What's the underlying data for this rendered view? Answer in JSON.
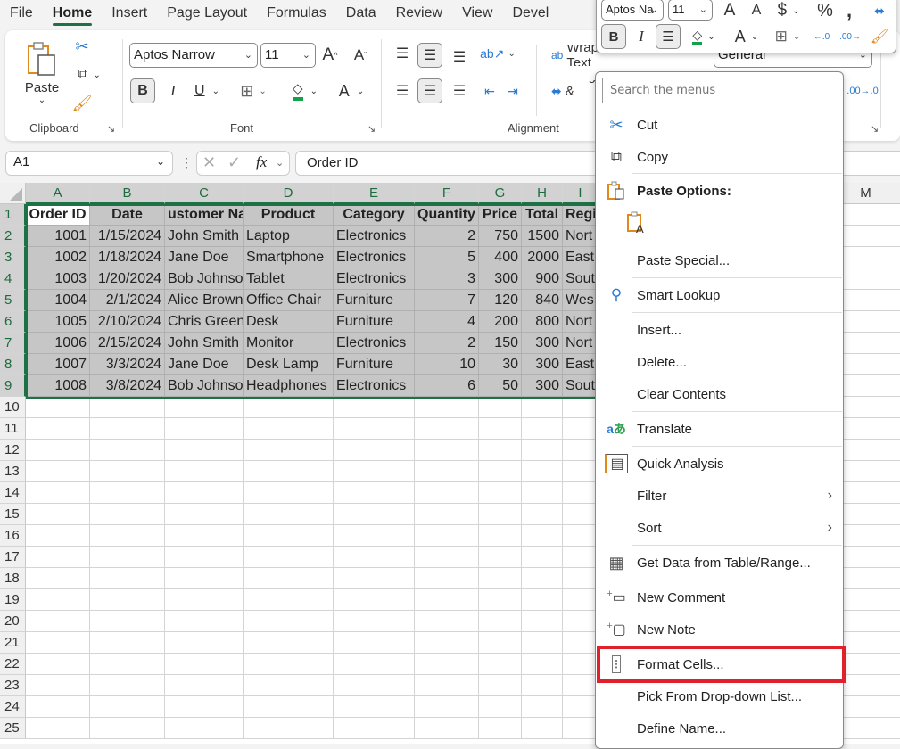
{
  "tabs": [
    "File",
    "Home",
    "Insert",
    "Page Layout",
    "Formulas",
    "Data",
    "Review",
    "View",
    "Devel"
  ],
  "active_tab": "Home",
  "ribbon": {
    "clipboard": {
      "label": "Clipboard",
      "paste": "Paste"
    },
    "font": {
      "label": "Font",
      "name": "Aptos Narrow",
      "size": "11",
      "bold": "B",
      "italic": "I",
      "underline": "U",
      "font_color": "A"
    },
    "alignment": {
      "label": "Alignment",
      "wrap_text": "Wrap Text",
      "merge": "Merge & Center"
    },
    "number": {
      "format": "General"
    }
  },
  "mini_toolbar": {
    "font": "Aptos Na",
    "size": "11",
    "bold": "B",
    "italic": "I",
    "font_color": "A"
  },
  "formula_bar": {
    "name_box": "A1",
    "fx": "fx",
    "value": "Order ID"
  },
  "columns": [
    "A",
    "B",
    "C",
    "D",
    "E",
    "F",
    "G",
    "H",
    "I",
    "M"
  ],
  "rows": [
    "1",
    "2",
    "3",
    "4",
    "5",
    "6",
    "7",
    "8",
    "9",
    "10",
    "11",
    "12",
    "13",
    "14",
    "15",
    "16",
    "17",
    "18",
    "19",
    "20",
    "21",
    "22",
    "23",
    "24",
    "25"
  ],
  "table": {
    "headers": [
      "Order ID",
      "Date",
      "ustomer Nan",
      "Product",
      "Category",
      "Quantity",
      "Price",
      "Total",
      "Regi"
    ],
    "data": [
      [
        "1001",
        "1/15/2024",
        "John Smith",
        "Laptop",
        "Electronics",
        "2",
        "750",
        "1500",
        "Nort"
      ],
      [
        "1002",
        "1/18/2024",
        "Jane Doe",
        "Smartphone",
        "Electronics",
        "5",
        "400",
        "2000",
        "East"
      ],
      [
        "1003",
        "1/20/2024",
        "Bob Johnsor",
        "Tablet",
        "Electronics",
        "3",
        "300",
        "900",
        "Sout"
      ],
      [
        "1004",
        "2/1/2024",
        "Alice Brown",
        "Office Chair",
        "Furniture",
        "7",
        "120",
        "840",
        "Wes"
      ],
      [
        "1005",
        "2/10/2024",
        "Chris Green",
        "Desk",
        "Furniture",
        "4",
        "200",
        "800",
        "Nort"
      ],
      [
        "1006",
        "2/15/2024",
        "John Smith",
        "Monitor",
        "Electronics",
        "2",
        "150",
        "300",
        "Nort"
      ],
      [
        "1007",
        "3/3/2024",
        "Jane Doe",
        "Desk Lamp",
        "Furniture",
        "10",
        "30",
        "300",
        "East"
      ],
      [
        "1008",
        "3/8/2024",
        "Bob Johnsor",
        "Headphones",
        "Electronics",
        "6",
        "50",
        "300",
        "Sout"
      ]
    ]
  },
  "context_menu": {
    "search_placeholder": "Search the menus",
    "items": [
      {
        "label": "Cut",
        "icon": "scissors-icon"
      },
      {
        "label": "Copy",
        "icon": "copy-icon"
      },
      {
        "label": "Paste Options:",
        "icon": "clipboard-icon"
      },
      {
        "label": "",
        "icon": "paste-values-icon"
      },
      {
        "label": "Paste Special...",
        "icon": ""
      },
      {
        "label": "Smart Lookup",
        "icon": "smart-lookup-icon"
      },
      {
        "label": "Insert...",
        "icon": ""
      },
      {
        "label": "Delete...",
        "icon": ""
      },
      {
        "label": "Clear Contents",
        "icon": ""
      },
      {
        "label": "Translate",
        "icon": "translate-icon"
      },
      {
        "label": "Quick Analysis",
        "icon": "quick-analysis-icon"
      },
      {
        "label": "Filter",
        "icon": ""
      },
      {
        "label": "Sort",
        "icon": ""
      },
      {
        "label": "Get Data from Table/Range...",
        "icon": "table-icon"
      },
      {
        "label": "New Comment",
        "icon": "new-comment-icon"
      },
      {
        "label": "New Note",
        "icon": "new-note-icon"
      },
      {
        "label": "Format Cells...",
        "icon": "format-cells-icon"
      },
      {
        "label": "Pick From Drop-down List...",
        "icon": ""
      },
      {
        "label": "Define Name...",
        "icon": ""
      }
    ],
    "highlighted": "Format Cells..."
  },
  "colors": {
    "accent": "#1e7145",
    "highlight": "#e0202a",
    "selection": "#c6c6c6"
  }
}
